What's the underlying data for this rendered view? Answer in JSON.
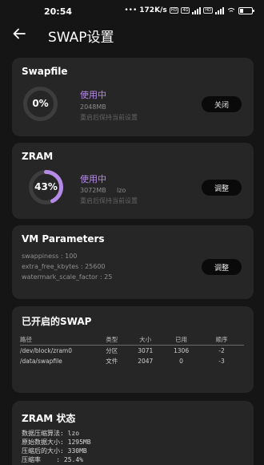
{
  "status_bar": {
    "time": "20:54",
    "speed": "172K/s",
    "tag_hd": "HD",
    "tag_4g": "4G",
    "tag_hd2": "HD"
  },
  "header": {
    "title": "SWAP设置",
    "back_icon": "arrow-left-icon"
  },
  "swapfile": {
    "title": "Swapfile",
    "percent": "0%",
    "usage_fraction": 0.0,
    "status": "使用中",
    "size": "2048MB",
    "note": "重启后保持当前设置",
    "button": "关闭"
  },
  "zram": {
    "title": "ZRAM",
    "percent": "43%",
    "usage_fraction": 0.43,
    "status": "使用中",
    "size": "3072MB",
    "algo": "lzo",
    "note": "重启后保持当前设置",
    "button": "调整"
  },
  "vm": {
    "title": "VM Parameters",
    "lines": [
      "swappiness : 100",
      "extra_free_kbytes : 25600",
      "watermark_scale_factor : 25"
    ],
    "button": "调整"
  },
  "swaps": {
    "title": "已开启的SWAP",
    "headers": [
      "路径",
      "类型",
      "大小",
      "已用",
      "顺序"
    ],
    "rows": [
      [
        "/dev/block/zram0",
        "分区",
        "3071",
        "1306",
        "-2"
      ],
      [
        "/data/swapfile",
        "文件",
        "2047",
        "0",
        "-3"
      ]
    ]
  },
  "zram_status": {
    "title": "ZRAM 状态",
    "lines": [
      "数据压缩算法: lzo",
      "原始数据大小: 1295MB",
      "压缩后的大小: 330MB",
      "压缩率    : 25.4%"
    ]
  },
  "colors": {
    "accent": "#b58be8",
    "card": "#262626",
    "background": "#151515"
  }
}
